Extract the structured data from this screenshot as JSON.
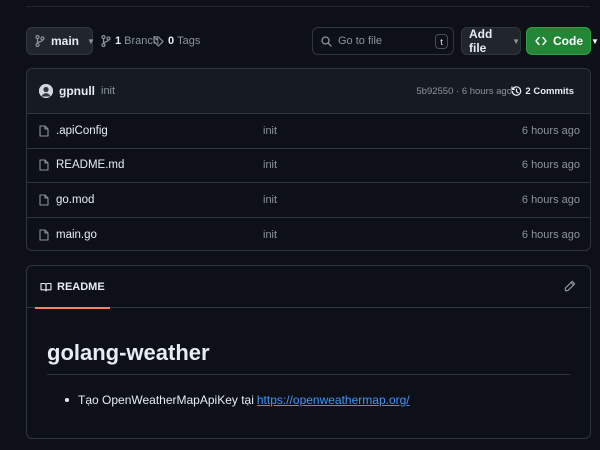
{
  "toolbar": {
    "branch": "main",
    "branch_count": "1",
    "branch_label": "Branch",
    "tag_count": "0",
    "tag_label": "Tags",
    "search_placeholder": "Go to file",
    "search_shortcut": "t",
    "add_file": "Add file",
    "code": "Code"
  },
  "commit": {
    "author": "gpnull",
    "message": "init",
    "hash_time": "5b92550 · 6 hours ago",
    "count": "2 Commits"
  },
  "files": [
    {
      "name": ".apiConfig",
      "message": "init",
      "age": "6 hours ago"
    },
    {
      "name": "README.md",
      "message": "init",
      "age": "6 hours ago"
    },
    {
      "name": "go.mod",
      "message": "init",
      "age": "6 hours ago"
    },
    {
      "name": "main.go",
      "message": "init",
      "age": "6 hours ago"
    }
  ],
  "readme": {
    "tab": "README",
    "title": "golang-weather",
    "bullet_text": "Tạo OpenWeatherMapApiKey tại",
    "bullet_link": "https://openweathermap.org/"
  },
  "colors": {
    "background": "#0d1117",
    "border": "#30363d",
    "code_button": "#238636",
    "link": "#4493f8",
    "tab_underline": "#f78166"
  }
}
